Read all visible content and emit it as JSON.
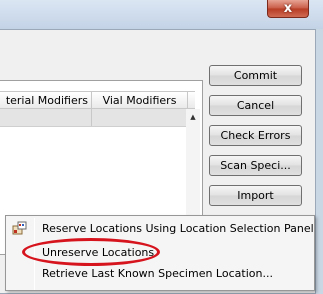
{
  "window": {
    "close_glyph": "x"
  },
  "grid": {
    "columns": [
      "terial Modifiers",
      "Vial Modifiers"
    ],
    "scroll_up_glyph": "▲"
  },
  "buttons": {
    "commit": "Commit",
    "cancel": "Cancel",
    "check_errors": "Check Errors",
    "scan_specimens": "Scan Speci...",
    "import": "Import"
  },
  "context_menu": {
    "items": [
      {
        "label": "Reserve Locations Using Location Selection Panel",
        "icon": "location-panel-icon"
      },
      {
        "label": "Unreserve Locations",
        "icon": ""
      },
      {
        "label": "Retrieve Last Known Specimen Location...",
        "icon": ""
      }
    ]
  },
  "annotation": {
    "highlight_color": "#d6141e",
    "shape": "ellipse"
  }
}
